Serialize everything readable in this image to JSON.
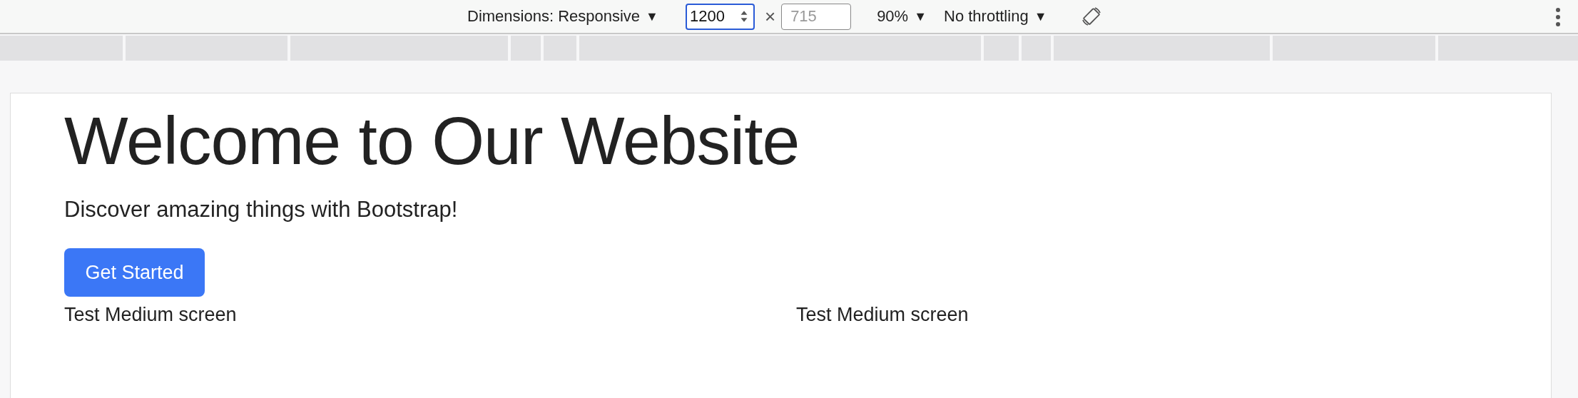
{
  "toolbar": {
    "dimensions": {
      "label": "Dimensions: Responsive",
      "caret": "▼"
    },
    "width": {
      "value": "1200"
    },
    "times": "×",
    "height": {
      "placeholder": "715"
    },
    "zoom": {
      "label": "90%",
      "caret": "▼"
    },
    "throttling": {
      "label": "No throttling",
      "caret": "▼"
    }
  },
  "page": {
    "heading": "Welcome to Our Website",
    "subtitle": "Discover amazing things with Bootstrap!",
    "button": "Get Started",
    "columns": [
      "Test Medium screen",
      "Test Medium screen"
    ]
  }
}
